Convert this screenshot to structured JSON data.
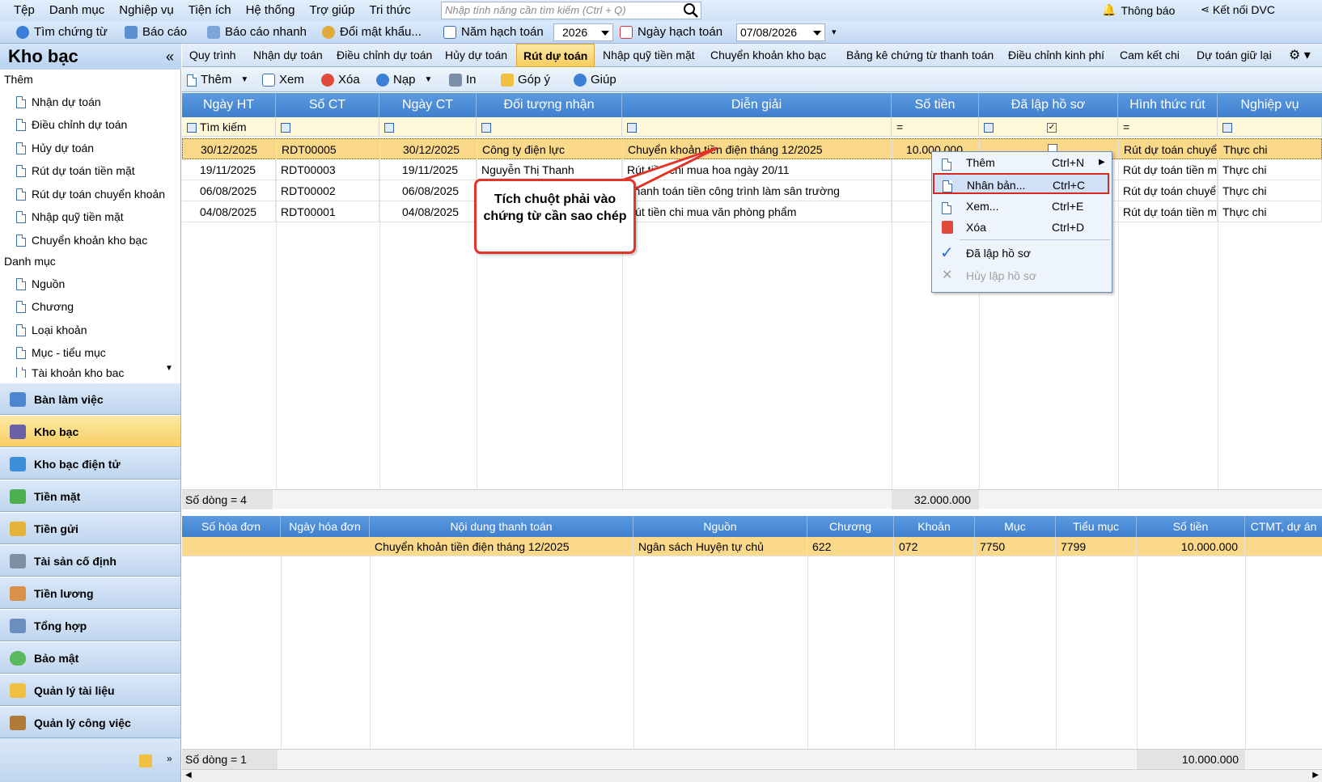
{
  "menubar": {
    "items": [
      "Tệp",
      "Danh mục",
      "Nghiệp vụ",
      "Tiện ích",
      "Hệ thống",
      "Trợ giúp",
      "Tri thức"
    ],
    "search_placeholder": "Nhập tính năng cần tìm kiếm (Ctrl + Q)",
    "notification": "Thông báo",
    "connect": "Kết nối DVC"
  },
  "toolbar1": {
    "find": "Tìm chứng từ",
    "report": "Báo cáo",
    "quick_report": "Báo cáo nhanh",
    "change_password": "Đổi mật khẩu...",
    "fiscal_year_label": "Năm hạch toán",
    "fiscal_year": "2026",
    "posting_date_label": "Ngày hạch toán",
    "posting_date": "07/08/2026"
  },
  "sidebar": {
    "title": "Kho bạc",
    "collapse": "«",
    "group_add": "Thêm",
    "add_items": [
      "Nhận dự toán",
      "Điều chỉnh dự toán",
      "Hủy dự toán",
      "Rút dự toán tiền mặt",
      "Rút dự toán chuyển khoản",
      "Nhập quỹ tiền mặt",
      "Chuyển khoản kho bạc"
    ],
    "group_catalog": "Danh mục",
    "catalog_items": [
      "Nguồn",
      "Chương",
      "Loại khoản",
      "Mục - tiểu mục",
      "Tài khoản kho bạc"
    ],
    "nav": [
      "Bàn làm việc",
      "Kho bạc",
      "Kho bạc điện tử",
      "Tiền mặt",
      "Tiền gửi",
      "Tài sản cố định",
      "Tiền lương",
      "Tổng hợp",
      "Bảo mật",
      "Quản lý tài liệu",
      "Quản lý công việc"
    ]
  },
  "tabs": [
    "Quy trình",
    "Nhận dự toán",
    "Điều chỉnh dự toán",
    "Hủy dự toán",
    "Rút dự toán",
    "Nhập quỹ tiền mặt",
    "Chuyển khoản kho bạc",
    "Bảng kê chứng từ thanh toán",
    "Điều chỉnh kinh phí",
    "Cam kết chi",
    "Dự toán giữ lại"
  ],
  "toolbar2": {
    "add": "Thêm",
    "view": "Xem",
    "delete": "Xóa",
    "reload": "Nạp",
    "print": "In",
    "feedback": "Góp ý",
    "help": "Giúp"
  },
  "grid": {
    "headers": [
      "Ngày HT",
      "Số CT",
      "Ngày CT",
      "Đối tượng nhận",
      "Diễn giải",
      "Số tiền",
      "Đã lập hồ sơ",
      "Hình thức rút",
      "Nghiệp vụ"
    ],
    "filter_label": "Tìm kiếm",
    "rows": [
      [
        "30/12/2025",
        "RDT00005",
        "30/12/2025",
        "Công ty điện lực",
        "Chuyển khoản tiền điện tháng 12/2025",
        "10.000.000",
        "",
        "Rút dự toán chuyển",
        "Thực chi"
      ],
      [
        "19/11/2025",
        "RDT00003",
        "19/11/2025",
        "Nguyễn Thị Thanh",
        "Rút tiền chi mua hoa ngày 20/11",
        "",
        "",
        "Rút dự toán tiền mặ",
        "Thực chi"
      ],
      [
        "06/08/2025",
        "RDT00002",
        "06/08/2025",
        "",
        "Thanh toán tiền công trình làm sân trường",
        "",
        "",
        "Rút dự toán chuyển",
        "Thực chi"
      ],
      [
        "04/08/2025",
        "RDT00001",
        "04/08/2025",
        "",
        "Rút tiền chi mua văn phòng phẩm",
        "",
        "",
        "Rút dự toán tiền mặ",
        "Thực chi"
      ]
    ],
    "footer_count": "Số dòng = 4",
    "footer_total": "32.000.000"
  },
  "detail": {
    "headers": [
      "Số hóa đơn",
      "Ngày hóa đơn",
      "Nội dung thanh toán",
      "Nguồn",
      "Chương",
      "Khoản",
      "Mục",
      "Tiểu mục",
      "Số tiền",
      "CTMT, dự án"
    ],
    "rows": [
      [
        "",
        "",
        "Chuyển khoản tiền điện tháng 12/2025",
        "Ngân sách Huyện tự chủ",
        "622",
        "072",
        "7750",
        "7799",
        "10.000.000",
        ""
      ]
    ],
    "footer_count": "Số dòng = 1",
    "footer_total": "10.000.000"
  },
  "context_menu": [
    {
      "label": "Thêm",
      "shortcut": "Ctrl+N"
    },
    {
      "label": "Nhân bản...",
      "shortcut": "Ctrl+C"
    },
    {
      "label": "Xem...",
      "shortcut": "Ctrl+E"
    },
    {
      "label": "Xóa",
      "shortcut": "Ctrl+D"
    },
    {
      "label": "Đã lập hồ sơ",
      "shortcut": ""
    },
    {
      "label": "Hủy lập hồ sơ",
      "shortcut": ""
    }
  ],
  "callout": "Tích chuột phải vào chứng từ cần sao chép"
}
